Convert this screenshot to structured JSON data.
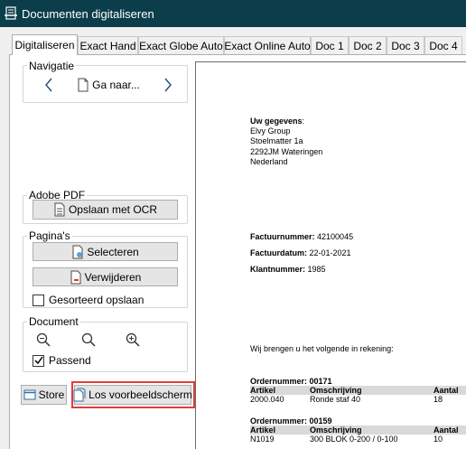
{
  "window": {
    "title": "Documenten digitaliseren"
  },
  "tabs": [
    {
      "label": "Digitaliseren"
    },
    {
      "label": "Exact Hand"
    },
    {
      "label": "Exact Globe Auto"
    },
    {
      "label": "Exact Online Auto"
    },
    {
      "label": "Doc 1"
    },
    {
      "label": "Doc 2"
    },
    {
      "label": "Doc 3"
    },
    {
      "label": "Doc 4"
    }
  ],
  "navigatie": {
    "label": "Navigatie",
    "goto_label": "Ga naar..."
  },
  "adobe": {
    "label": "Adobe PDF",
    "ocr_label": "Opslaan met OCR"
  },
  "paginas": {
    "label": "Pagina's",
    "select_label": "Selecteren",
    "delete_label": "Verwijderen",
    "sorted_label": "Gesorteerd opslaan",
    "sorted_checked": false
  },
  "document": {
    "label": "Document",
    "fit_label": "Passend",
    "fit_checked": true
  },
  "bottom": {
    "store_label": "Store",
    "detach_label": "Los voorbeeldscherm"
  },
  "preview": {
    "details_heading": "Uw gegevens",
    "details_colon": ":",
    "details_lines": [
      "Elvy Group",
      "Stoelmatter 1a",
      "2292JM Wateringen",
      "Nederland"
    ],
    "invoice_number_label": "Factuurnummer:",
    "invoice_number": "42100045",
    "invoice_date_label": "Factuurdatum:",
    "invoice_date": "22-01-2021",
    "client_number_label": "Klantnummer:",
    "client_number": "1985",
    "intro": "Wij brengen u het volgende in rekening:",
    "orders": [
      {
        "heading": "Ordernummer: 00171",
        "columns": [
          "Artikel",
          "Omschrijving",
          "Aantal"
        ],
        "row": [
          "2000.040",
          "Ronde staf 40",
          "18"
        ]
      },
      {
        "heading": "Ordernummer: 00159",
        "columns": [
          "Artikel",
          "Omschrijving",
          "Aantal"
        ],
        "row": [
          "N1019",
          "300 BLOK 0-200 / 0-100",
          "10"
        ]
      }
    ]
  },
  "colors": {
    "titlebar": "#0b3e4a",
    "highlight": "#e03c3c",
    "table_header": "#d9d9d9"
  }
}
